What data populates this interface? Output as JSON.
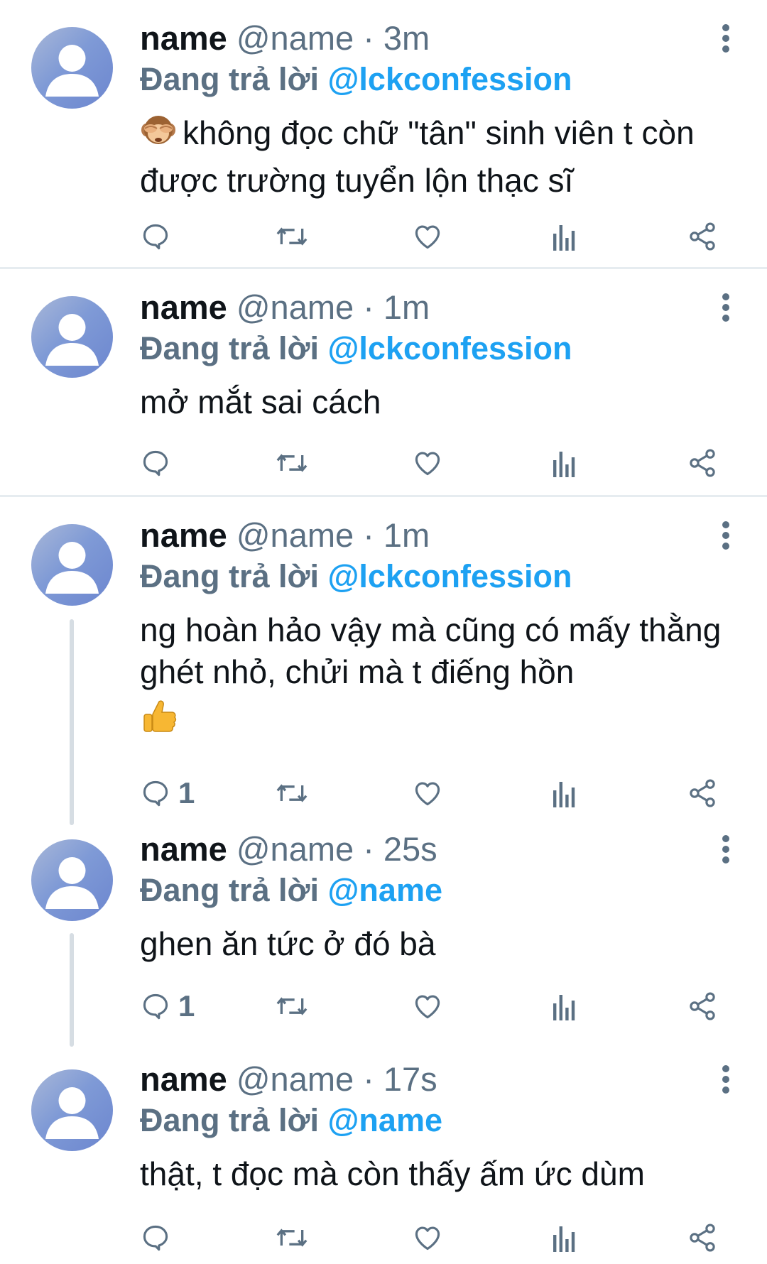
{
  "colors": {
    "accent": "#1da1f2",
    "muted": "#5b7083",
    "text": "#0f1419",
    "divider": "#e6ecf0"
  },
  "tweets": [
    {
      "name": "name",
      "handle": "@name",
      "sep": "·",
      "time": "3m",
      "reply_prefix": "Đang trả lời",
      "reply_to": "@lckconfession",
      "emoji": "see-no-evil-monkey",
      "text": "không đọc chữ \"tân\" sinh viên t còn được trường tuyển lộn thạc sĩ",
      "reply_count": ""
    },
    {
      "name": "name",
      "handle": "@name",
      "sep": "·",
      "time": "1m",
      "reply_prefix": "Đang trả lời",
      "reply_to": "@lckconfession",
      "text": "mở mắt sai cách",
      "reply_count": ""
    },
    {
      "name": "name",
      "handle": "@name",
      "sep": "·",
      "time": "1m",
      "reply_prefix": "Đang trả lời",
      "reply_to": "@lckconfession",
      "text": "ng hoàn hảo vậy mà cũng có mấy thằng ghét nhỏ, chửi mà t điếng hồn",
      "trailing_emoji": "thumbs-up",
      "reply_count": "1"
    },
    {
      "name": "name",
      "handle": "@name",
      "sep": "·",
      "time": "25s",
      "reply_prefix": "Đang trả lời",
      "reply_to": "@name",
      "text": "ghen ăn tức ở đó bà",
      "reply_count": "1"
    },
    {
      "name": "name",
      "handle": "@name",
      "sep": "·",
      "time": "17s",
      "reply_prefix": "Đang trả lời",
      "reply_to": "@name",
      "text": "thật, t đọc mà còn thấy ấm ức dùm",
      "reply_count": ""
    }
  ],
  "icons": {
    "reply": "reply-icon",
    "retweet": "retweet-icon",
    "like": "heart-icon",
    "analytics": "analytics-icon",
    "share": "share-icon",
    "more": "more-vertical-icon"
  }
}
